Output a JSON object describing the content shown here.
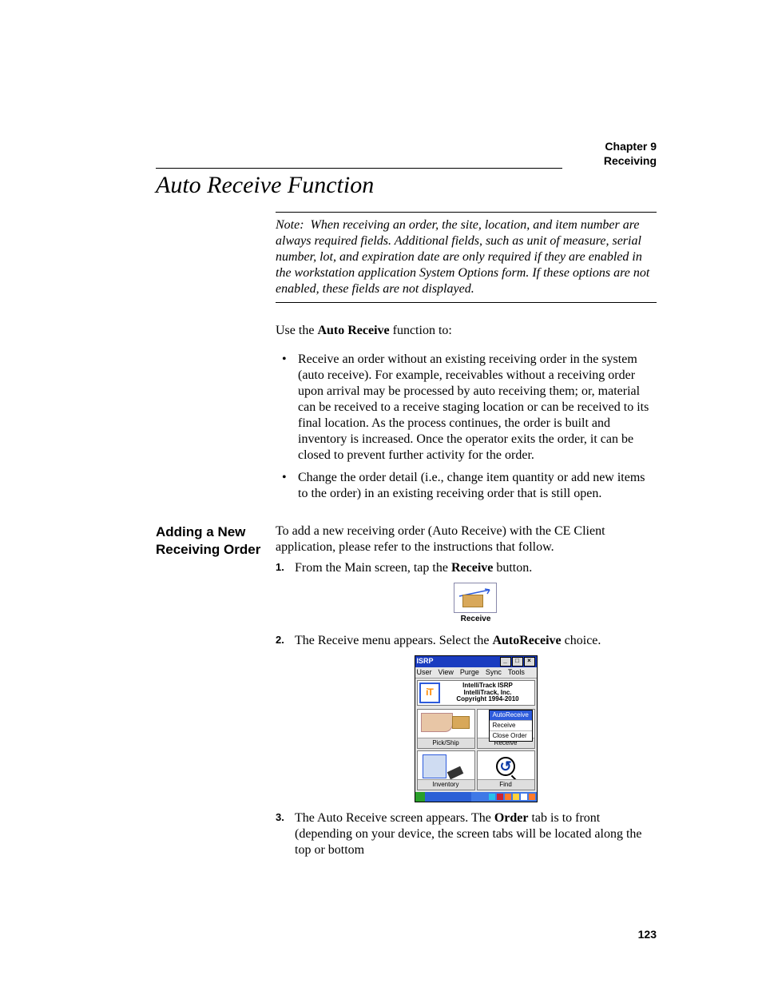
{
  "header": {
    "chapter": "Chapter 9",
    "section": "Receiving"
  },
  "title": "Auto Receive Function",
  "note": {
    "label": "Note:",
    "text": "When receiving an order, the site, location, and item number are always required fields. Additional fields, such as unit of measure, serial number, lot, and expiration date are only required if they are enabled in the workstation application System Options form. If these options are not enabled, these fields are not displayed."
  },
  "intro": {
    "pre": "Use the ",
    "bold": "Auto Receive",
    "post": " function to:"
  },
  "bullets": [
    "Receive an order without an existing receiving order in the system (auto receive). For example, receivables without a receiving order upon arrival may be processed by auto receiving them; or, material can be received to a receive staging location or can be received to its final location. As the process continues, the order is built and inventory is increased. Once the operator exits the order, it can be closed to prevent further activity for the order.",
    "Change the order detail (i.e., change item quantity or add new items to the order) in an existing receiving order that is still open."
  ],
  "subsection": {
    "heading": "Adding a New Receiving Order",
    "lead": "To add a new receiving order (Auto Receive) with the CE Client application, please refer to the instructions that follow.",
    "steps": {
      "s1": {
        "pre": "From the Main screen, tap the ",
        "bold": "Receive",
        "post": " button."
      },
      "s2": {
        "pre": "The Receive menu appears. Select the ",
        "bold": "AutoReceive",
        "post": " choice."
      },
      "s3": {
        "pre": "The Auto Receive screen appears. The ",
        "bold": "Order",
        "post": " tab is to front (depending on your device, the screen tabs will be located along the top or bottom"
      }
    }
  },
  "figures": {
    "receive_button_label": "Receive",
    "isrp": {
      "title": "ISRP",
      "menus": [
        "User",
        "View",
        "Purge",
        "Sync",
        "Tools"
      ],
      "brand_lines": [
        "IntelliTrack ISRP",
        "IntelliTrack, Inc.",
        "Copyright 1994-2010"
      ],
      "cells": {
        "pick_ship": "Pick/Ship",
        "receive": "Receive",
        "inventory": "Inventory",
        "find": "Find"
      },
      "receive_menu": [
        "AutoReceive",
        "Receive",
        "Close Order"
      ]
    }
  },
  "page_number": "123"
}
